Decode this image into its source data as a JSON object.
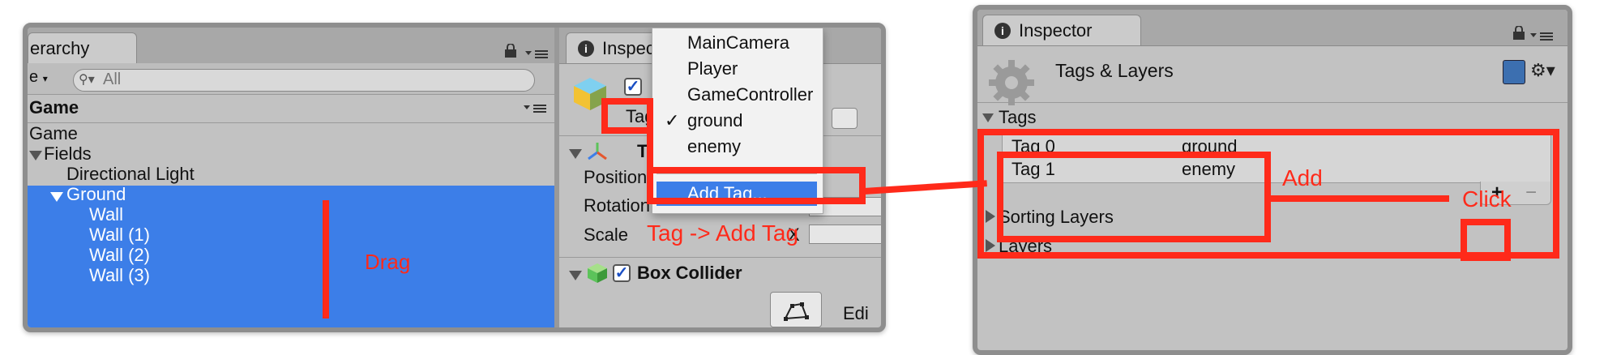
{
  "hierarchy": {
    "tab_label": "erarchy",
    "create_label": "e",
    "search_placeholder": "All",
    "scene_name": "Game",
    "items": [
      {
        "label": "Game"
      },
      {
        "label": "Fields"
      },
      {
        "label": "Directional Light"
      },
      {
        "label": "Ground"
      },
      {
        "label": "Wall"
      },
      {
        "label": "Wall (1)"
      },
      {
        "label": "Wall (2)"
      },
      {
        "label": "Wall (3)"
      }
    ],
    "selection_color": "#3c7ee8"
  },
  "left_inspector": {
    "tab_label": "Inspec",
    "tag_label": "Tag",
    "transform_label": "T",
    "rows": [
      "Position",
      "Rotation",
      "Scale"
    ],
    "x_label": "X",
    "box_collider_label": "Box Collider",
    "edit_label": "Edi"
  },
  "tag_dropdown": {
    "options": [
      "MainCamera",
      "Player",
      "GameController",
      "ground",
      "enemy"
    ],
    "checked": "ground",
    "checkmark": "✓",
    "add_tag_label": "Add Tag...",
    "highlight_color": "#3c7ee8"
  },
  "right_inspector": {
    "tab_label": "Inspector",
    "title": "Tags & Layers",
    "tags_header": "Tags",
    "tags": [
      {
        "name": "Tag 0",
        "value": "ground"
      },
      {
        "name": "Tag 1",
        "value": "enemy"
      }
    ],
    "add_button": "+",
    "remove_button": "−",
    "sorting_layers": "Sorting Layers",
    "layers": "Layers"
  },
  "annotations": {
    "drag": "Drag",
    "tag_add_tag": "Tag -> Add Tag",
    "add": "Add",
    "click": "Click",
    "color": "#ff2a1a"
  }
}
